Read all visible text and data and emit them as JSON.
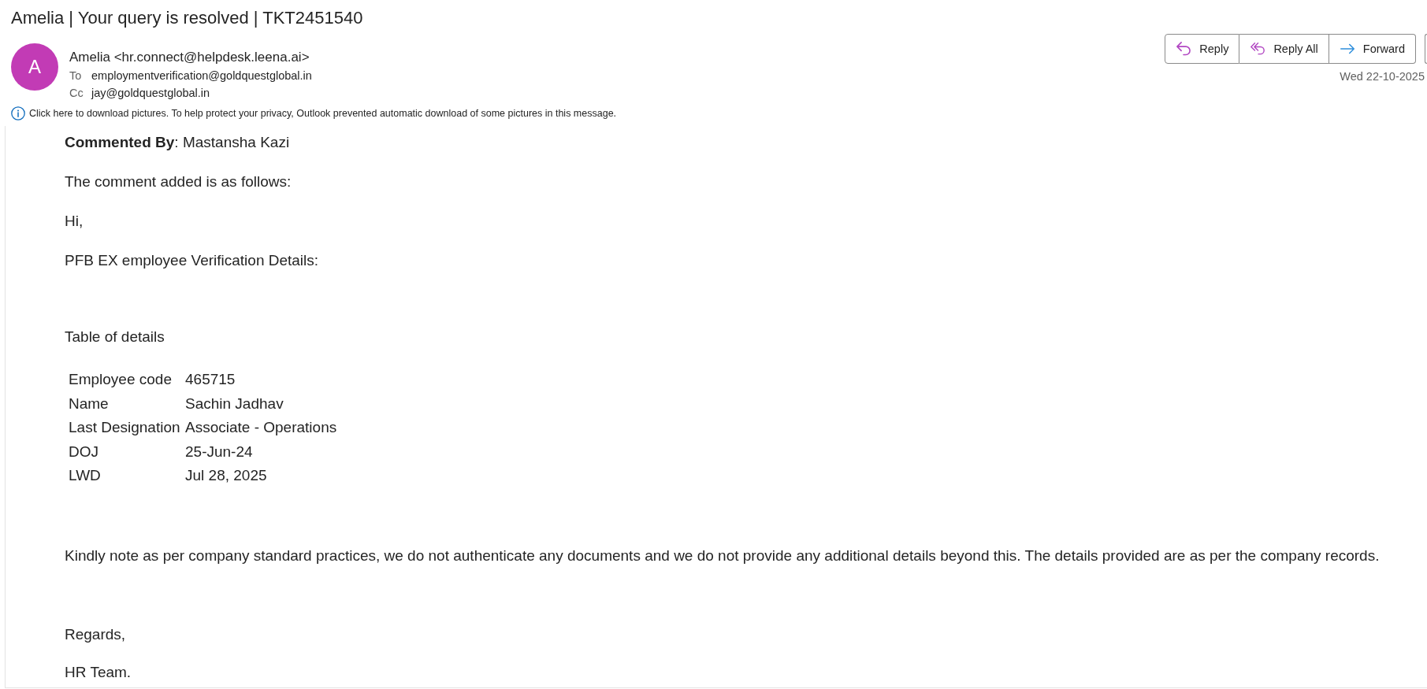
{
  "subject": "Amelia | Your query is resolved | TKT2451540",
  "sender": {
    "avatar_initial": "A",
    "name_line": "Amelia <hr.connect@helpdesk.leena.ai>",
    "to_label": "To",
    "to": "employmentverification@goldquestglobal.in",
    "cc_label": "Cc",
    "cc": "jay@goldquestglobal.in"
  },
  "actions": [
    {
      "label": "Reply",
      "kind": "reply"
    },
    {
      "label": "Reply All",
      "kind": "reply_all"
    },
    {
      "label": "Forward",
      "kind": "forward"
    }
  ],
  "date": "Wed 22-10-2025",
  "info_bar": "Click here to download pictures. To help protect your privacy, Outlook prevented automatic download of some pictures in this message.",
  "body": {
    "commented_by": "**Commented By**: Mastansha Kazi",
    "paragraphs": [
      "The comment added is as follows:",
      "Hi,",
      "PFB EX employee Verification Details:"
    ],
    "table_title": "Table of details",
    "details": [
      {
        "label": "Employee code",
        "value": "465715"
      },
      {
        "label": "Name",
        "value": "Sachin Jadhav"
      },
      {
        "label": "Last Designation",
        "value": "Associate - Operations"
      },
      {
        "label": "DOJ",
        "value": "25-Jun-24"
      },
      {
        "label": "LWD",
        "value": "Jul 28, 2025"
      }
    ],
    "note": "Kindly note as per company standard practices, we do not authenticate any documents and we do not provide any additional details beyond this. The details provided are as per the company records.",
    "closing": "Regards,",
    "signature": "HR Team."
  }
}
